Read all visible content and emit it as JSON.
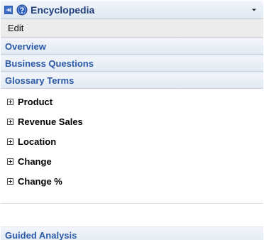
{
  "panel": {
    "title": "Encyclopedia",
    "edit_label": "Edit"
  },
  "sections": {
    "overview": "Overview",
    "business_questions": "Business Questions",
    "glossary_terms": "Glossary Terms",
    "guided_analysis": "Guided Analysis"
  },
  "glossary": {
    "items": [
      {
        "label": "Product"
      },
      {
        "label": "Revenue Sales"
      },
      {
        "label": "Location"
      },
      {
        "label": "Change"
      },
      {
        "label": "Change %"
      }
    ]
  },
  "icons": {
    "collapse": "collapse-panel-icon",
    "help": "help-icon",
    "dropdown": "chevron-down-icon",
    "expander": "plus-box-icon"
  },
  "colors": {
    "title_text": "#1f3f7a",
    "section_text": "#2a5aa8",
    "accent_button": "#3f6ec9",
    "edit_bar_bg": "#ececec"
  }
}
